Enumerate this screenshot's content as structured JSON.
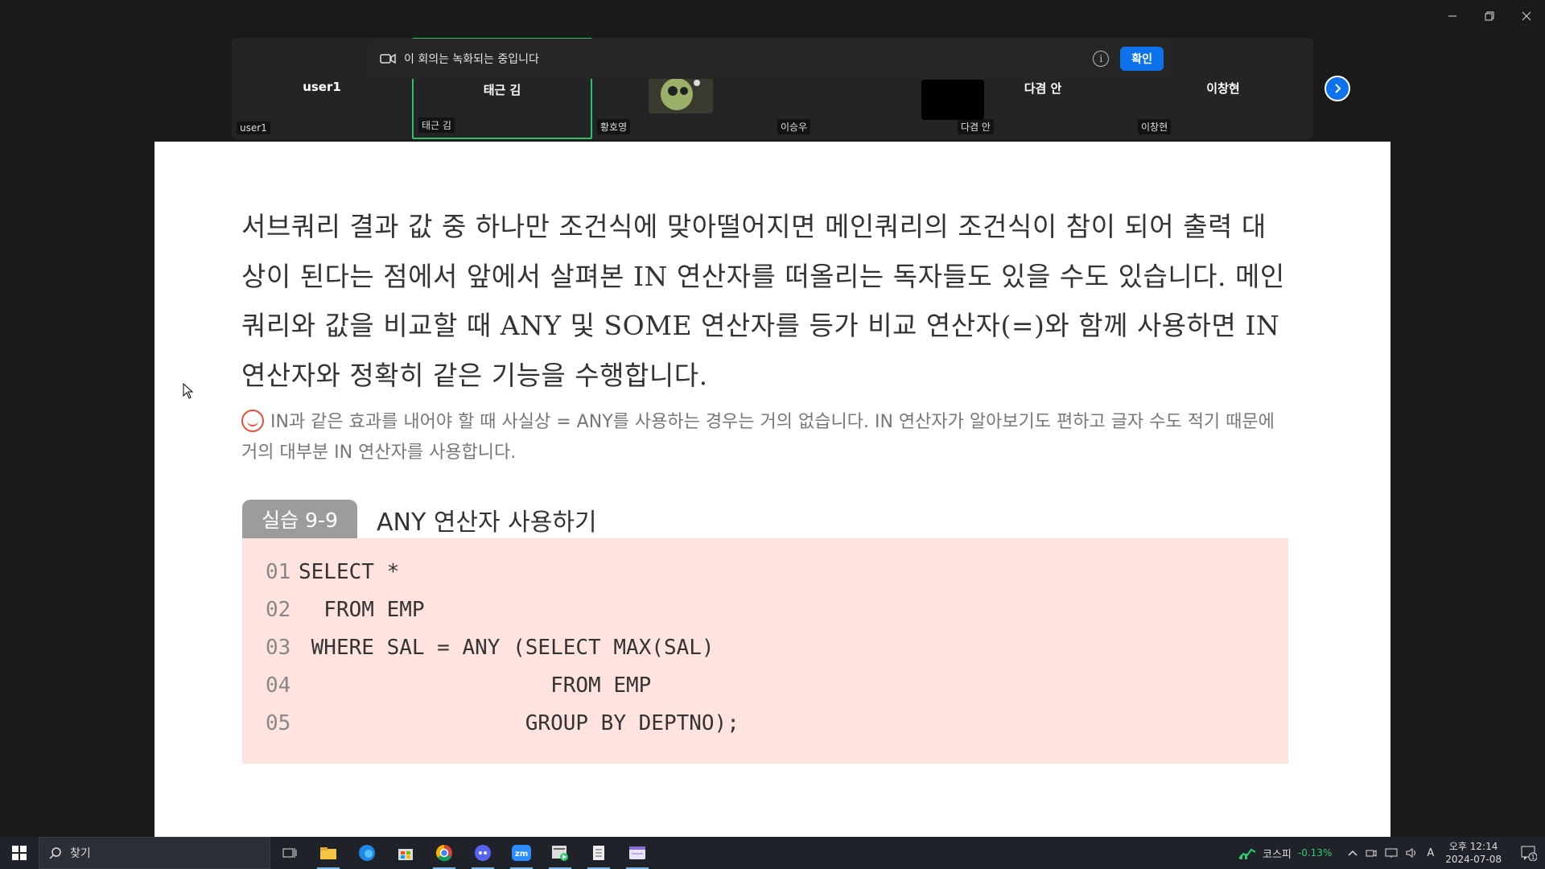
{
  "recording_banner": {
    "text": "이 회의는 녹화되는 중입니다",
    "ok_label": "확인"
  },
  "participants": [
    {
      "big_name": "user1",
      "small_name": "user1"
    },
    {
      "big_name": "태근 김",
      "small_name": "태근 김",
      "active": true
    },
    {
      "big_name": "",
      "small_name": "황호영"
    },
    {
      "big_name": "",
      "small_name": "이승우"
    },
    {
      "big_name": "다겸 안",
      "small_name": "다겸 안"
    },
    {
      "big_name": "이창현",
      "small_name": "이창현"
    }
  ],
  "document": {
    "paragraph": "서브쿼리 결과 값 중 하나만 조건식에 맞아떨어지면 메인쿼리의 조건식이 참이 되어 출력 대상이 된다는 점에서 앞에서 살펴본 IN 연산자를 떠올리는 독자들도 있을 수도 있습니다. 메인쿼리와 값을 비교할 때 ANY 및 SOME 연산자를 등가 비교 연산자(=)와 함께 사용하면 IN 연산자와 정확히 같은 기능을 수행합니다.",
    "tip": "IN과 같은 효과를 내어야 할 때 사실상 = ANY를 사용하는 경우는 거의 없습니다. IN 연산자가 알아보기도 편하고 글자 수도 적기 때문에 거의 대부분 IN 연산자를 사용합니다.",
    "example_label": "실습 9-9",
    "example_title": "ANY 연산자 사용하기",
    "code": [
      {
        "ln": "01",
        "text": "SELECT *"
      },
      {
        "ln": "02",
        "text": "  FROM EMP"
      },
      {
        "ln": "03",
        "text": " WHERE SAL = ANY (SELECT MAX(SAL)"
      },
      {
        "ln": "04",
        "text": "                    FROM EMP"
      },
      {
        "ln": "05",
        "text": "                  GROUP BY DEPTNO);"
      }
    ]
  },
  "taskbar": {
    "search_placeholder": "찾기",
    "stock_name": "코스피",
    "stock_change": "-0.13%",
    "ime": "A",
    "time": "오후 12:14",
    "date": "2024-07-08",
    "notification_count": "1"
  },
  "colors": {
    "accent": "#0e72ed",
    "active_border": "#2fbf71",
    "code_bg": "#ffe3de"
  }
}
